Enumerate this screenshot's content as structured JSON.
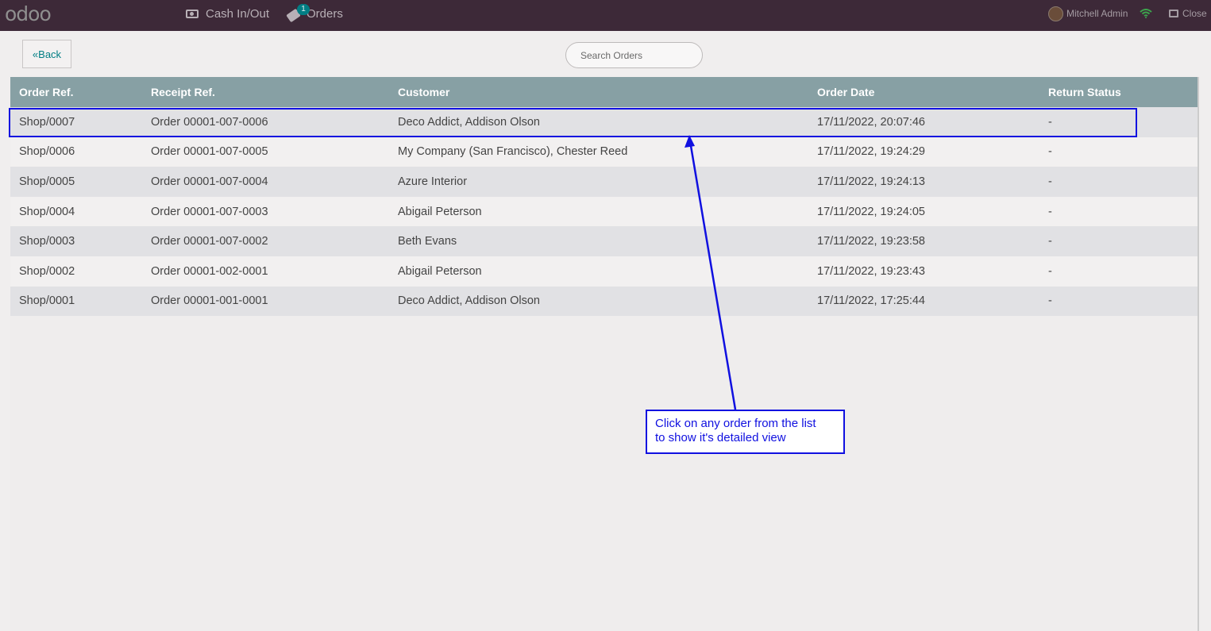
{
  "topbar": {
    "logo": "odoo",
    "cash_label": "Cash In/Out",
    "orders_label": "Orders",
    "orders_badge": "1",
    "user_name": "Mitchell Admin",
    "close_label": "Close"
  },
  "toolbar": {
    "back_label": "Back",
    "back_icon": "«",
    "search_placeholder": "Search Orders"
  },
  "table": {
    "headers": [
      "Order Ref.",
      "Receipt Ref.",
      "Customer",
      "Order Date",
      "Return Status"
    ],
    "rows": [
      [
        "Shop/0007",
        "Order 00001-007-0006",
        "Deco Addict, Addison Olson",
        "17/11/2022, 20:07:46",
        "-"
      ],
      [
        "Shop/0006",
        "Order 00001-007-0005",
        "My Company (San Francisco), Chester Reed",
        "17/11/2022, 19:24:29",
        "-"
      ],
      [
        "Shop/0005",
        "Order 00001-007-0004",
        "Azure Interior",
        "17/11/2022, 19:24:13",
        "-"
      ],
      [
        "Shop/0004",
        "Order 00001-007-0003",
        "Abigail Peterson",
        "17/11/2022, 19:24:05",
        "-"
      ],
      [
        "Shop/0003",
        "Order 00001-007-0002",
        "Beth Evans",
        "17/11/2022, 19:23:58",
        "-"
      ],
      [
        "Shop/0002",
        "Order 00001-002-0001",
        "Abigail Peterson",
        "17/11/2022, 19:23:43",
        "-"
      ],
      [
        "Shop/0001",
        "Order 00001-001-0001",
        "Deco Addict, Addison Olson",
        "17/11/2022, 17:25:44",
        "-"
      ]
    ]
  },
  "annotation": {
    "line1": "Click on any order from the list",
    "line2": "to show it's detailed view",
    "color": "#1010e0"
  },
  "colors": {
    "topbar": "#3d2938",
    "header": "#87a0a4",
    "accent": "#017e84"
  }
}
